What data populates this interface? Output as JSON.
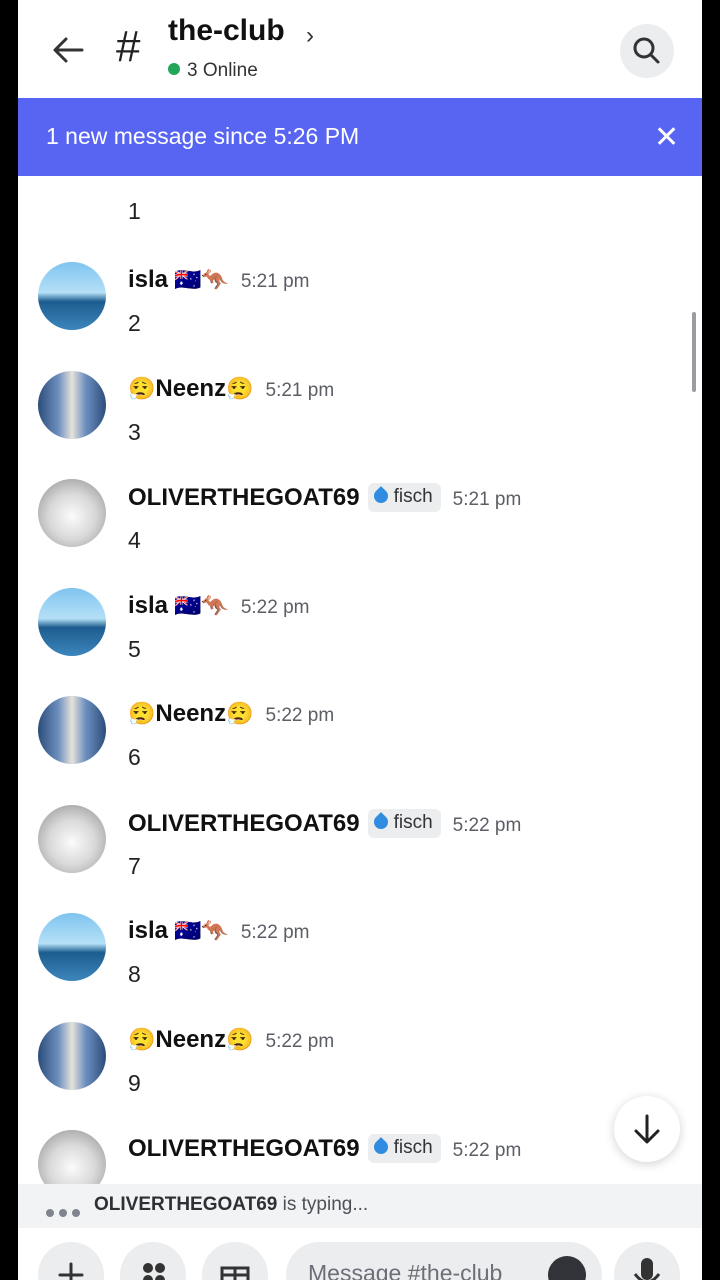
{
  "header": {
    "channel_title": "the-club",
    "chevron": "›",
    "hash": "#",
    "online_text": "3 Online"
  },
  "banner": {
    "text": "1 new message since 5:26 PM",
    "close": "✕"
  },
  "partial_message": {
    "body": "1"
  },
  "messages": [
    {
      "author": "isla",
      "flags": "🇦🇺🦘",
      "time": "5:21 pm",
      "body": "2",
      "avatar": "beach"
    },
    {
      "author": "Neenz",
      "prefix": "😮‍💨",
      "suffix": "😮‍💨",
      "time": "5:21 pm",
      "body": "3",
      "avatar": "person"
    },
    {
      "author": "OLIVERTHEGOAT69",
      "tag": "fisch",
      "time": "5:21 pm",
      "body": "4",
      "avatar": "cat"
    },
    {
      "author": "isla",
      "flags": "🇦🇺🦘",
      "time": "5:22 pm",
      "body": "5",
      "avatar": "beach"
    },
    {
      "author": "Neenz",
      "prefix": "😮‍💨",
      "suffix": "😮‍💨",
      "time": "5:22 pm",
      "body": "6",
      "avatar": "person"
    },
    {
      "author": "OLIVERTHEGOAT69",
      "tag": "fisch",
      "time": "5:22 pm",
      "body": "7",
      "avatar": "cat"
    },
    {
      "author": "isla",
      "flags": "🇦🇺🦘",
      "time": "5:22 pm",
      "body": "8",
      "avatar": "beach"
    },
    {
      "author": "Neenz",
      "prefix": "😮‍💨",
      "suffix": "😮‍💨",
      "time": "5:22 pm",
      "body": "9",
      "avatar": "person"
    },
    {
      "author": "OLIVERTHEGOAT69",
      "tag": "fisch",
      "time": "5:22 pm",
      "body": "",
      "avatar": "cat"
    }
  ],
  "typing": {
    "user": "OLIVERTHEGOAT69",
    "text": " is typing..."
  },
  "composer": {
    "placeholder": "Message #the-club"
  },
  "colors": {
    "brand": "#5865f2",
    "online": "#23a55a"
  },
  "icons": [
    "back-arrow-icon",
    "search-icon",
    "close-icon",
    "arrow-down-icon",
    "plus-icon",
    "apps-icon",
    "gift-icon",
    "emoji-icon",
    "microphone-icon"
  ]
}
